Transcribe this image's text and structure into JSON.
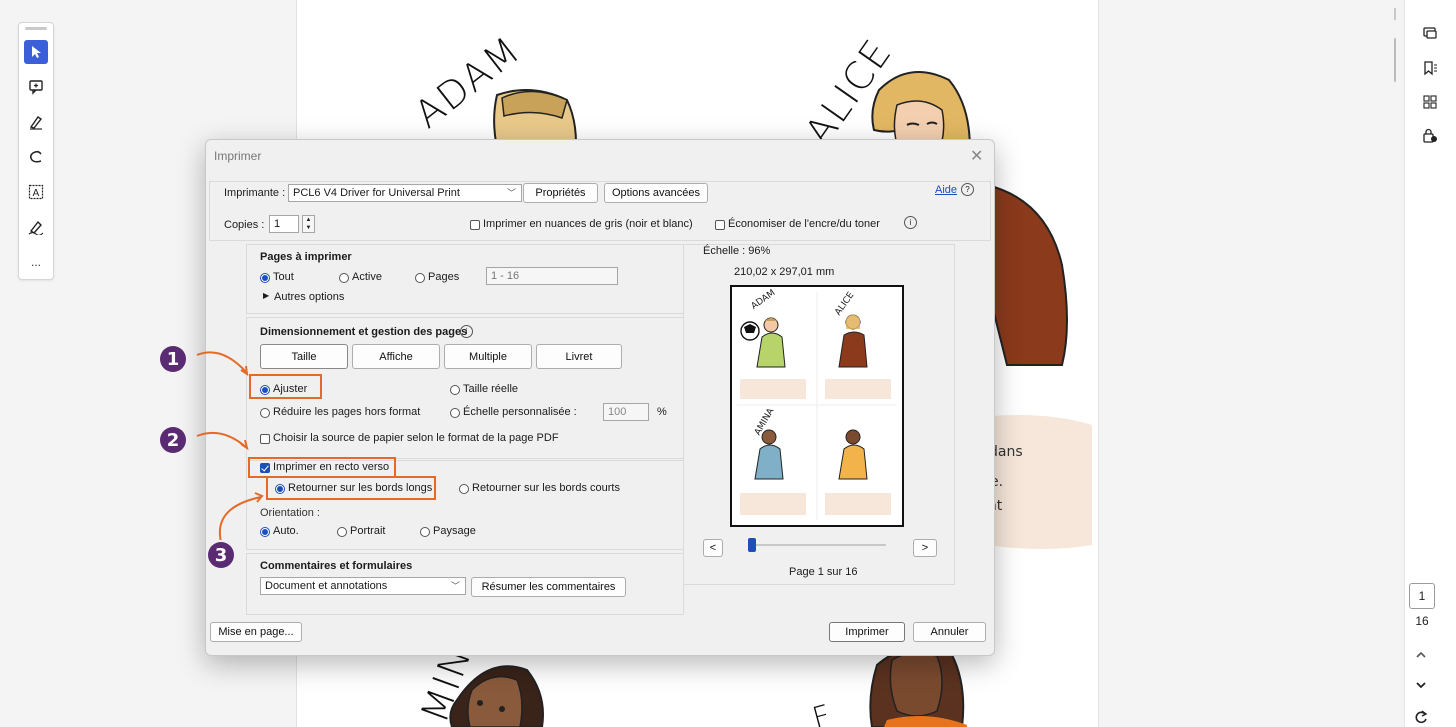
{
  "document": {
    "names": [
      "ADAM",
      "ALICE",
      "AMINA",
      "F"
    ],
    "side_text": [
      "dans",
      "utée.",
      "ement"
    ]
  },
  "left_toolbar": {
    "tools": [
      "select-icon",
      "comment-icon",
      "highlight-icon",
      "draw-icon",
      "text-select-icon",
      "sign-icon",
      "more-icon"
    ],
    "more_label": "..."
  },
  "right_rail": {
    "current_page": "1",
    "total_pages": "16"
  },
  "dialog": {
    "title": "Imprimer",
    "printer_label": "Imprimante :",
    "printer_value": "PCL6 V4 Driver for Universal Print",
    "properties_btn": "Propriétés",
    "advanced_btn": "Options avancées",
    "help_link": "Aide",
    "copies_label": "Copies :",
    "copies_value": "1",
    "grayscale_label": "Imprimer en nuances de gris (noir et blanc)",
    "save_ink_label": "Économiser de l'encre/du toner",
    "pages_section": {
      "title": "Pages à imprimer",
      "all": "Tout",
      "active": "Active",
      "pages": "Pages",
      "pages_range": "1 - 16",
      "more_options": "Autres options"
    },
    "sizing_section": {
      "title": "Dimensionnement et gestion des pages",
      "tabs": [
        "Taille",
        "Affiche",
        "Multiple",
        "Livret"
      ],
      "fit": "Ajuster",
      "actual_size": "Taille réelle",
      "shrink": "Réduire les pages hors format",
      "custom_scale": "Échelle personnalisée :",
      "custom_scale_value": "100",
      "percent": "%",
      "paper_source": "Choisir la source de papier selon le format de la page PDF"
    },
    "duplex_section": {
      "duplex": "Imprimer en recto verso",
      "long_edge": "Retourner sur les bords longs",
      "short_edge": "Retourner sur les bords courts",
      "orientation_label": "Orientation :",
      "auto": "Auto.",
      "portrait": "Portrait",
      "landscape": "Paysage"
    },
    "comments_section": {
      "title": "Commentaires et formulaires",
      "value": "Document et annotations",
      "summarize_btn": "Résumer les commentaires"
    },
    "preview": {
      "scale": "Échelle : 96%",
      "dimensions": "210,02 x 297,01 mm",
      "prev": "<",
      "next": ">",
      "page_label": "Page 1 sur 16"
    },
    "page_setup_btn": "Mise en page...",
    "print_btn": "Imprimer",
    "cancel_btn": "Annuler"
  },
  "annotations": {
    "badge_1": "1",
    "badge_2": "2",
    "badge_3": "3",
    "accent_color": "#e36b27",
    "badge_color": "#5a2a72"
  }
}
